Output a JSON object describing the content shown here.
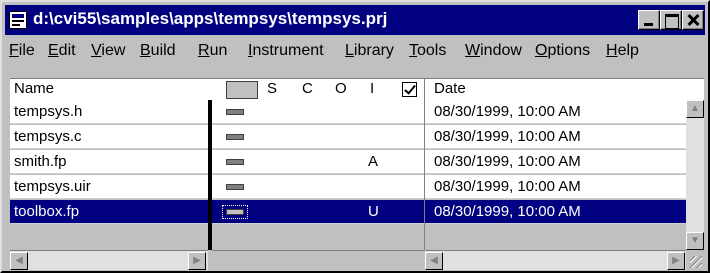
{
  "window": {
    "title": "d:\\cvi55\\samples\\apps\\tempsys\\tempsys.prj"
  },
  "menu": [
    {
      "key": "F",
      "rest": "ile"
    },
    {
      "key": "E",
      "rest": "dit"
    },
    {
      "key": "V",
      "rest": "iew"
    },
    {
      "key": "B",
      "rest": "uild"
    },
    {
      "key": "R",
      "rest": "un"
    },
    {
      "key": "I",
      "rest": "nstrument"
    },
    {
      "key": "L",
      "rest": "ibrary"
    },
    {
      "key": "T",
      "rest": "ools"
    },
    {
      "key": "W",
      "rest": "indow"
    },
    {
      "key": "O",
      "rest": "ptions"
    },
    {
      "key": "H",
      "rest": "elp"
    }
  ],
  "header": {
    "name": "Name",
    "letters": [
      "S",
      "C",
      "O",
      "I"
    ],
    "date": "Date"
  },
  "rows": [
    {
      "name": "tempsys.h",
      "attr": "",
      "date": "08/30/1999, 10:00 AM",
      "selected": false
    },
    {
      "name": "tempsys.c",
      "attr": "",
      "date": "08/30/1999, 10:00 AM",
      "selected": false
    },
    {
      "name": "smith.fp",
      "attr": "A",
      "date": "08/30/1999, 10:00 AM",
      "selected": false
    },
    {
      "name": "tempsys.uir",
      "attr": "",
      "date": "08/30/1999, 10:00 AM",
      "selected": false
    },
    {
      "name": "toolbox.fp",
      "attr": "U",
      "date": "08/30/1999, 10:00 AM",
      "selected": true
    }
  ],
  "colors": {
    "title_bar": "#000080",
    "selection": "#000080",
    "face": "#c0c0c0"
  }
}
